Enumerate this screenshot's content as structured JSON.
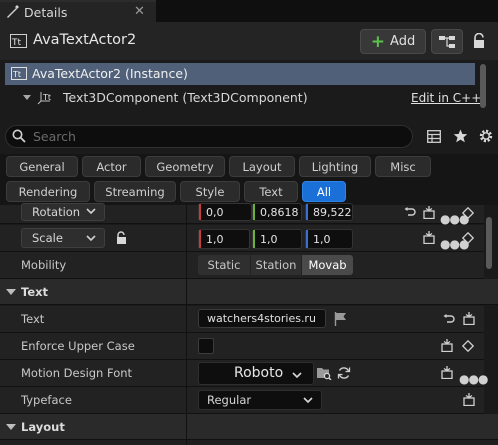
{
  "panel": {
    "tab_title": "Details",
    "actor_name": "AvaTextActor2",
    "add_label": "Add"
  },
  "tree": {
    "items": [
      {
        "label": "AvaTextActor2 (Instance)"
      },
      {
        "label": "Text3DComponent (Text3DComponent)"
      }
    ],
    "edit_link": "Edit in C++"
  },
  "search": {
    "placeholder": "Search"
  },
  "filters": [
    "General",
    "Actor",
    "Geometry",
    "Layout",
    "Lighting",
    "Misc",
    "Rendering",
    "Streaming",
    "Style",
    "Text",
    "All"
  ],
  "active_filter": "All",
  "transform": {
    "rotation": {
      "label": "Rotation",
      "values": [
        "0,0",
        "0,8618",
        "89,522"
      ]
    },
    "scale": {
      "label": "Scale",
      "values": [
        "1,0",
        "1,0",
        "1,0"
      ]
    },
    "mobility": {
      "label": "Mobility",
      "options": [
        "Static",
        "Station",
        "Movab"
      ],
      "selected": "Movab"
    }
  },
  "sections": {
    "text": {
      "title": "Text",
      "text_label": "Text",
      "text_value": "watchers4stories.ru",
      "enforce_label": "Enforce Upper Case",
      "font_label": "Motion Design Font",
      "font_value": "Roboto",
      "typeface_label": "Typeface",
      "typeface_value": "Regular"
    },
    "layout": {
      "title": "Layout"
    }
  },
  "colors": {
    "accent": "#1a70d6",
    "x_axis": "#c83b3b",
    "y_axis": "#6ab13a",
    "z_axis": "#3b6fd2",
    "selection": "#506079"
  }
}
